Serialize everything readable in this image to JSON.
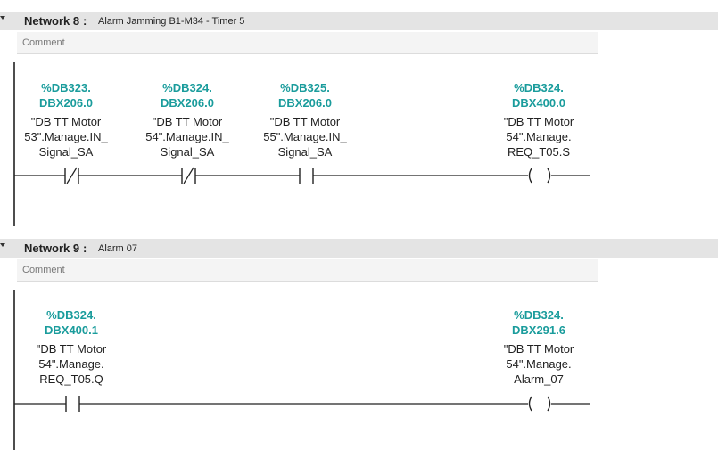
{
  "networks": [
    {
      "label": "Network 8",
      "separator": ":",
      "title": "Alarm Jamming B1-M34 - Timer 5",
      "comment_placeholder": "Comment",
      "contacts": [
        {
          "address_line1": "%DB323.",
          "address_line2": "DBX206.0",
          "tag_line1": "\"DB TT Motor",
          "tag_line2": "53\".Manage.IN_",
          "tag_line3": "Signal_SA",
          "type": "normally-closed"
        },
        {
          "address_line1": "%DB324.",
          "address_line2": "DBX206.0",
          "tag_line1": "\"DB TT Motor",
          "tag_line2": "54\".Manage.IN_",
          "tag_line3": "Signal_SA",
          "type": "normally-closed"
        },
        {
          "address_line1": "%DB325.",
          "address_line2": "DBX206.0",
          "tag_line1": "\"DB TT Motor",
          "tag_line2": "55\".Manage.IN_",
          "tag_line3": "Signal_SA",
          "type": "normally-open"
        }
      ],
      "coil": {
        "address_line1": "%DB324.",
        "address_line2": "DBX400.0",
        "tag_line1": "\"DB TT Motor",
        "tag_line2": "54\".Manage.",
        "tag_line3": "REQ_T05.S",
        "type": "coil"
      }
    },
    {
      "label": "Network 9",
      "separator": ":",
      "title": "Alarm 07",
      "comment_placeholder": "Comment",
      "contacts": [
        {
          "address_line1": "%DB324.",
          "address_line2": "DBX400.1",
          "tag_line1": "\"DB TT Motor",
          "tag_line2": "54\".Manage.",
          "tag_line3": "REQ_T05.Q",
          "type": "normally-open"
        }
      ],
      "coil": {
        "address_line1": "%DB324.",
        "address_line2": "DBX291.6",
        "tag_line1": "\"DB TT Motor",
        "tag_line2": "54\".Manage.",
        "tag_line3": "Alarm_07",
        "type": "coil"
      }
    }
  ],
  "colors": {
    "address": "#1a9c9c",
    "header_bg": "#e4e4e4",
    "comment_bg": "#f4f4f4",
    "wire": "#222222"
  }
}
